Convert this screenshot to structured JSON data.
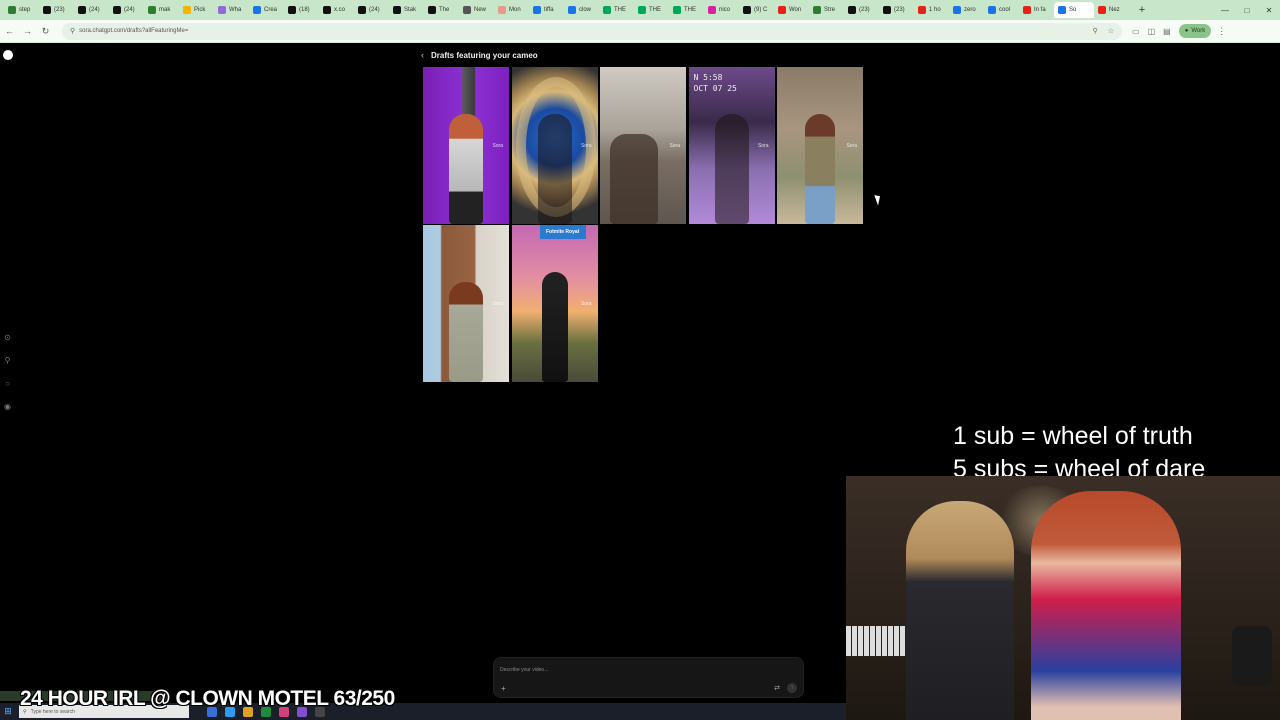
{
  "browser": {
    "tabs": [
      {
        "title": "step",
        "color": "#2e7d32"
      },
      {
        "title": "(23)",
        "color": "#111111"
      },
      {
        "title": "(24)",
        "color": "#111111"
      },
      {
        "title": "(24)",
        "color": "#111111"
      },
      {
        "title": "mak",
        "color": "#2e7d32"
      },
      {
        "title": "Pick",
        "color": "#f5b400"
      },
      {
        "title": "Wha",
        "color": "#8e6bd8"
      },
      {
        "title": "Crea",
        "color": "#1a73e8"
      },
      {
        "title": "(18)",
        "color": "#111111"
      },
      {
        "title": "x.co",
        "color": "#111111"
      },
      {
        "title": "(24)",
        "color": "#111111"
      },
      {
        "title": "Stak",
        "color": "#111111"
      },
      {
        "title": "The",
        "color": "#111111"
      },
      {
        "title": "New",
        "color": "#555555"
      },
      {
        "title": "Mon",
        "color": "#e89a8a"
      },
      {
        "title": "tiffa",
        "color": "#1a73e8"
      },
      {
        "title": "clow",
        "color": "#1a73e8"
      },
      {
        "title": "THE",
        "color": "#00a85a"
      },
      {
        "title": "THE",
        "color": "#00a85a"
      },
      {
        "title": "THE",
        "color": "#00a85a"
      },
      {
        "title": "nico",
        "color": "#d6249f"
      },
      {
        "title": "(9) C",
        "color": "#111111"
      },
      {
        "title": "Won",
        "color": "#e62117"
      },
      {
        "title": "Stre",
        "color": "#2e7d32"
      },
      {
        "title": "(23)",
        "color": "#111111"
      },
      {
        "title": "(23)",
        "color": "#111111"
      },
      {
        "title": "1 ho",
        "color": "#e62117"
      },
      {
        "title": "zero",
        "color": "#1a73e8"
      },
      {
        "title": "cool",
        "color": "#1a73e8"
      },
      {
        "title": "In fa",
        "color": "#e62117"
      },
      {
        "title": "So",
        "color": "#1a73e8",
        "active": true
      },
      {
        "title": "Nez",
        "color": "#e62117"
      }
    ],
    "new_tab": "+",
    "url": "sora.chatgpt.com/drafts?allFeaturingMe=",
    "profile_label": "Work"
  },
  "page": {
    "title": "Drafts featuring your cameo",
    "thumbnail_watermark": "Sora",
    "thumbnails": [
      {
        "label": ""
      },
      {
        "label": ""
      },
      {
        "label": ""
      },
      {
        "label": "N 5:58\nOCT 07 25"
      },
      {
        "label": ""
      },
      {
        "label": ""
      },
      {
        "label": "Fotmite Royal"
      }
    ],
    "composer_placeholder": "Describe your video...",
    "composer_plus": "+"
  },
  "overlay": {
    "rule_line_1": "1 sub = wheel of truth",
    "rule_line_2": "5 subs = wheel of dare",
    "stream_title": "24 HOUR IRL @ CLOWN MOTEL 63/250"
  },
  "taskbar": {
    "search_placeholder": "Type here to search"
  },
  "colors": {
    "background": "#000000",
    "tabstrip": "#c8e6c9",
    "accent": "#8bc48a"
  }
}
